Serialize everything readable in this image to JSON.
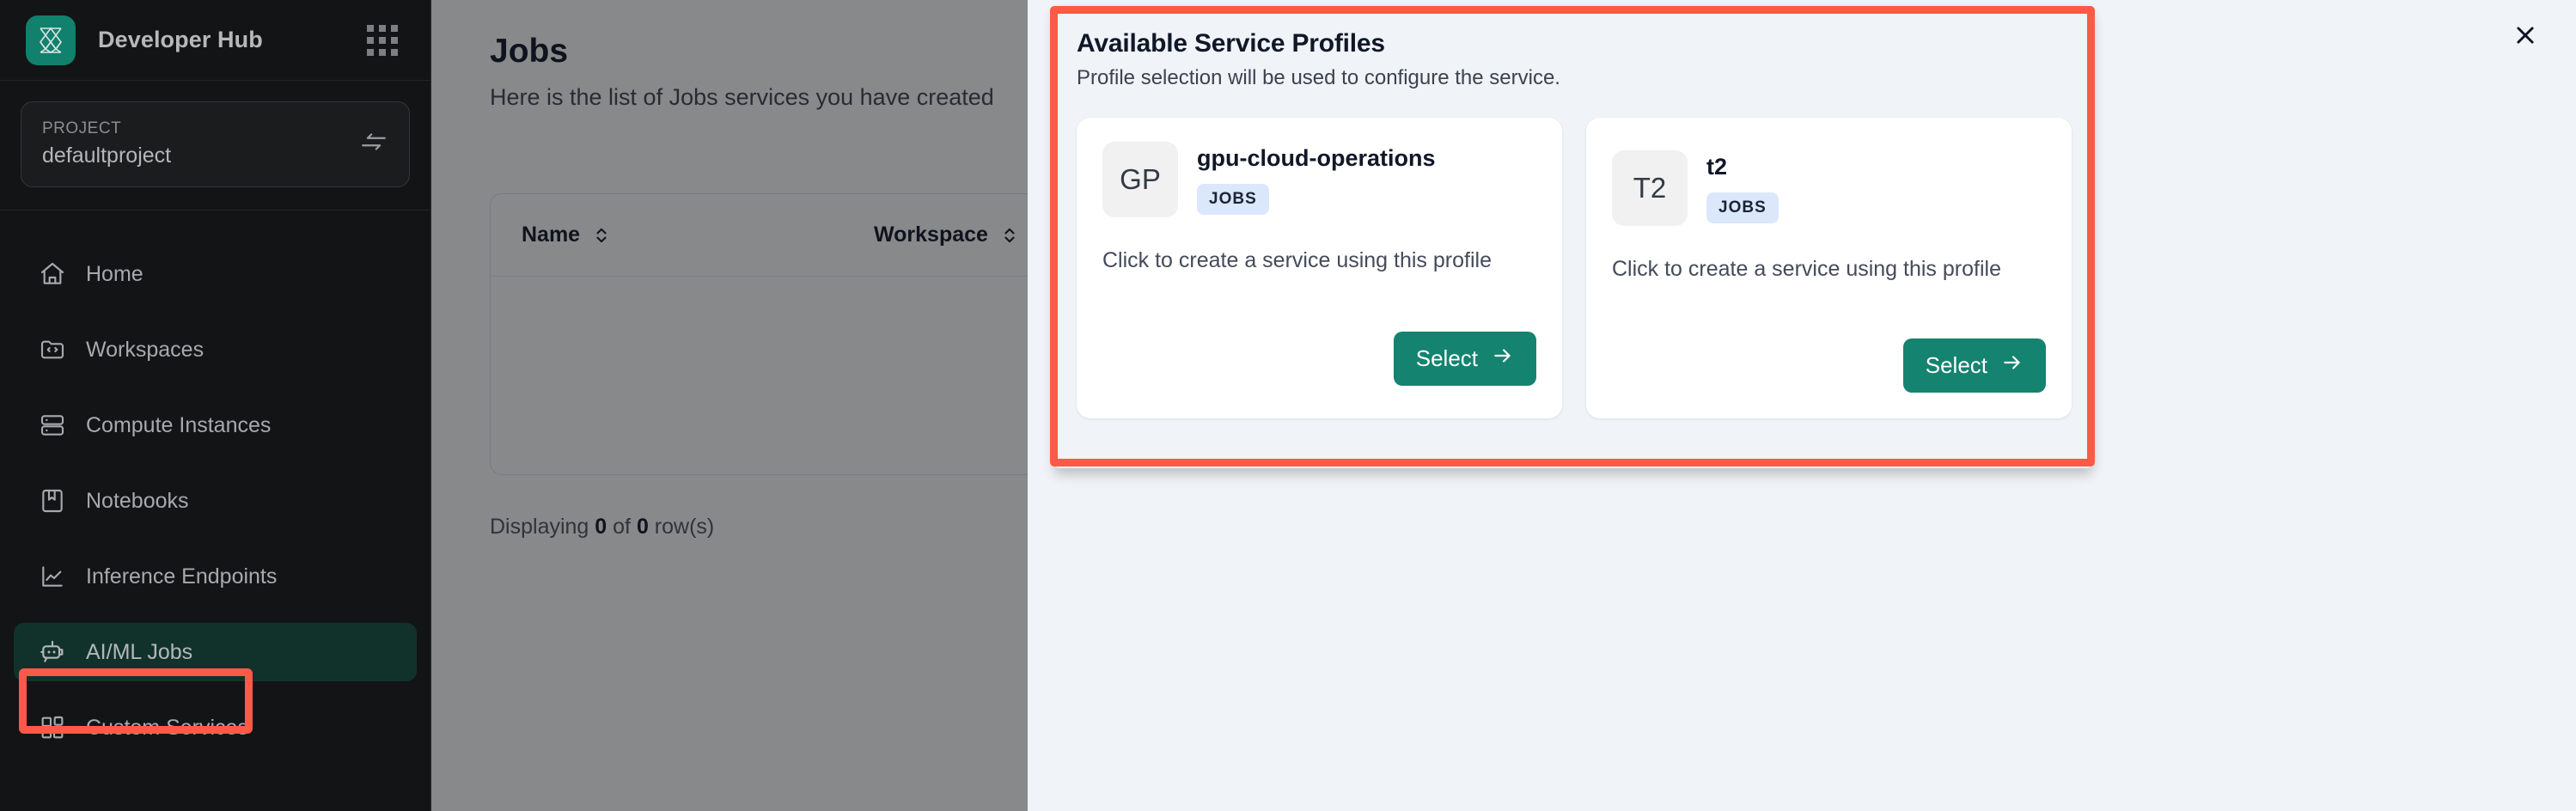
{
  "sidebar": {
    "brand": {
      "title": "Developer Hub",
      "logo_icon": "network-logo-icon",
      "apps_icon": "grid-apps-icon"
    },
    "project": {
      "label": "PROJECT",
      "value": "defaultproject",
      "switch_icon": "swap-arrows-icon"
    },
    "items": [
      {
        "label": "Home",
        "icon": "home-icon",
        "active": false
      },
      {
        "label": "Workspaces",
        "icon": "folder-code-icon",
        "active": false
      },
      {
        "label": "Compute Instances",
        "icon": "server-icon",
        "active": false
      },
      {
        "label": "Notebooks",
        "icon": "notebook-icon",
        "active": false
      },
      {
        "label": "Inference Endpoints",
        "icon": "line-chart-icon",
        "active": false
      },
      {
        "label": "AI/ML Jobs",
        "icon": "robot-icon",
        "active": true
      },
      {
        "label": "Custom Services",
        "icon": "blocks-icon",
        "active": false
      }
    ]
  },
  "main": {
    "title": "Jobs",
    "subtitle": "Here is the list of Jobs services you have created",
    "table": {
      "columns": [
        {
          "label": "Name",
          "sort_icon": "sort-chevrons-icon"
        },
        {
          "label": "Workspace",
          "sort_icon": "sort-chevrons-icon"
        }
      ],
      "rows": [],
      "footer_prefix": "Displaying ",
      "footer_shown": "0",
      "footer_mid": " of ",
      "footer_total": "0",
      "footer_suffix": " row(s)"
    }
  },
  "modal": {
    "title": "Available Service Profiles",
    "description": "Profile selection will be used to configure the service.",
    "close_icon": "close-icon",
    "profiles": [
      {
        "initials": "GP",
        "name": "gpu-cloud-operations",
        "badge": "JOBS",
        "hint": "Click to create a service using this profile",
        "button_label": "Select",
        "button_icon": "arrow-right-icon"
      },
      {
        "initials": "T2",
        "name": "t2",
        "badge": "JOBS",
        "hint": "Click to create a service using this profile",
        "button_label": "Select",
        "button_icon": "arrow-right-icon"
      }
    ]
  },
  "colors": {
    "brand_green": "#11806c",
    "button_green": "#14836f",
    "highlight_red": "#fb5a46",
    "sidebar_bg": "#131415",
    "active_nav_bg": "#11322a",
    "badge_blue": "#dbe7fb",
    "panel_bg": "#f0f3f7"
  }
}
